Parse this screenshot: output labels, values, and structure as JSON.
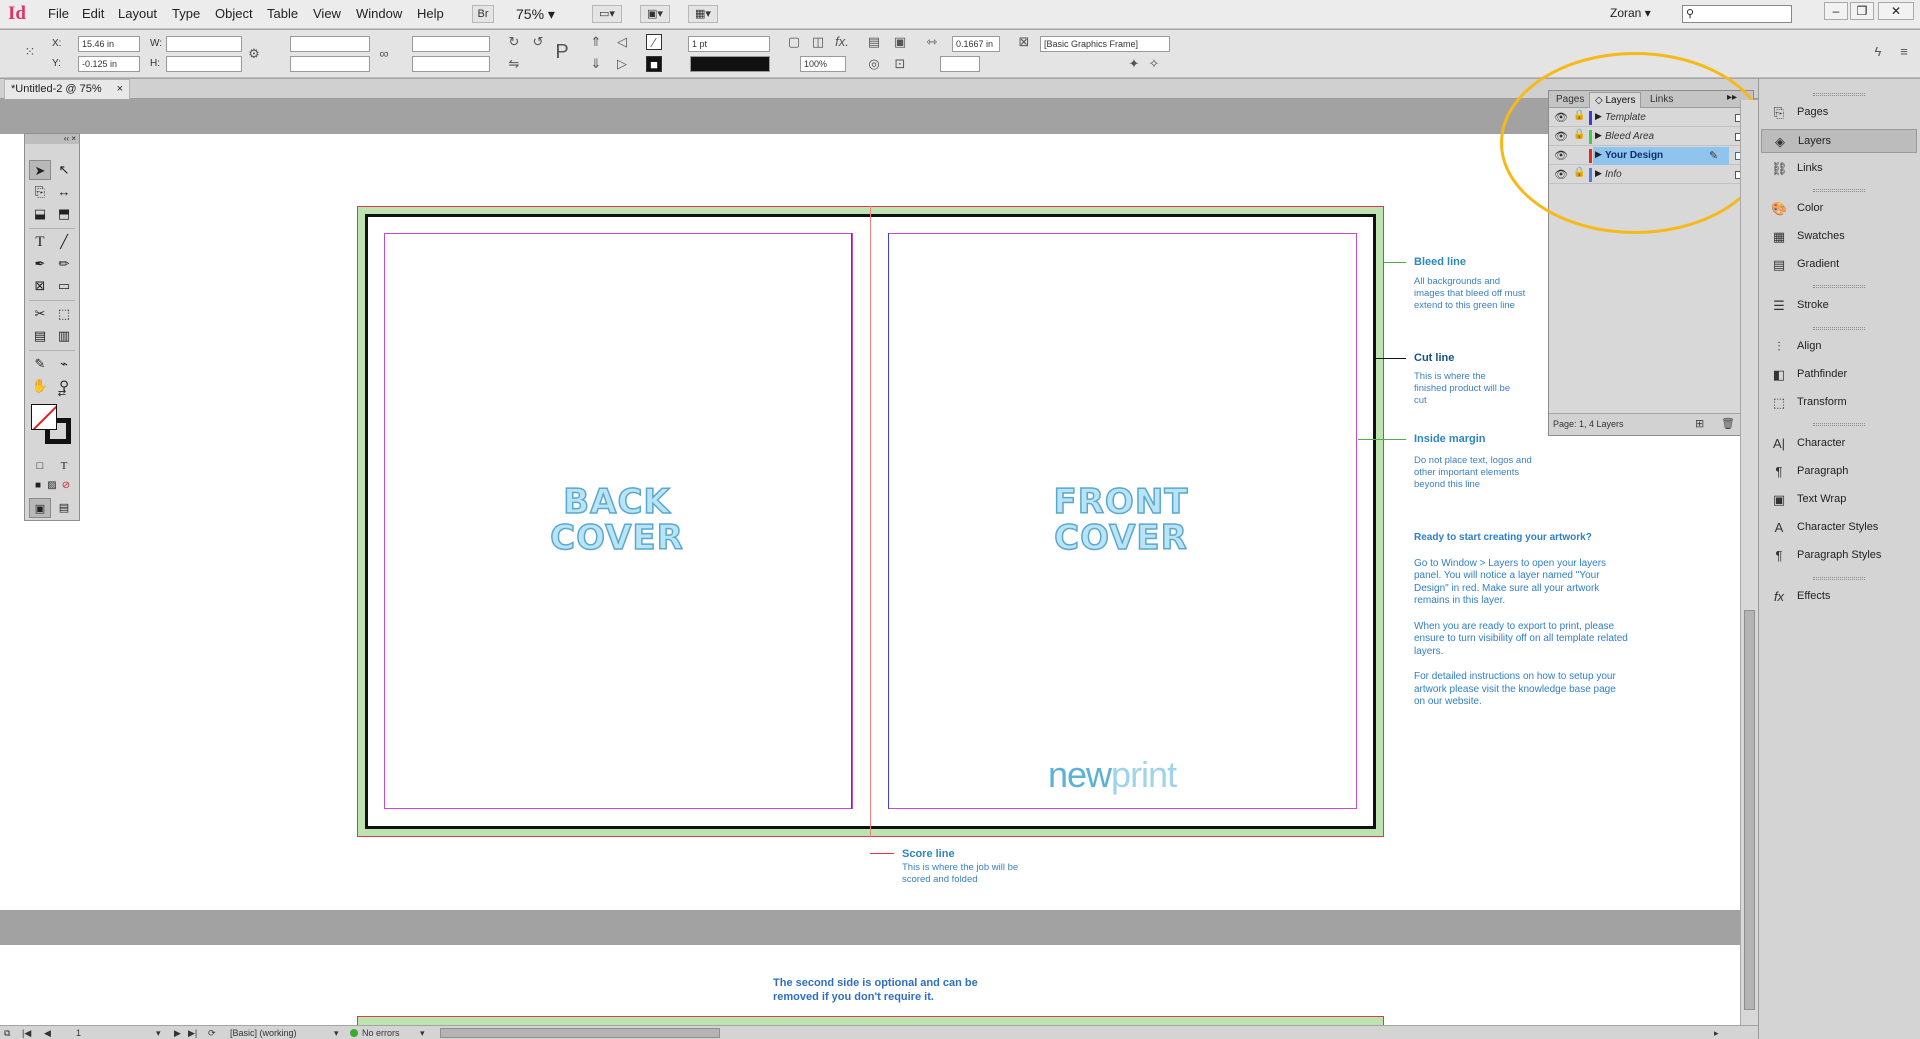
{
  "app": {
    "logo": "Id"
  },
  "menu": {
    "items": [
      "File",
      "Edit",
      "Layout",
      "Type",
      "Object",
      "Table",
      "View",
      "Window",
      "Help"
    ],
    "bridge_label": "Br",
    "zoom": "75%",
    "user": "Zoran"
  },
  "control": {
    "x_label": "X:",
    "y_label": "Y:",
    "w_label": "W:",
    "h_label": "H:",
    "x": "15.46 in",
    "y": "-0.125 in",
    "stroke_weight": "1 pt",
    "opacity": "100%",
    "offset": "0.1667 in",
    "object_style": "[Basic Graphics Frame]"
  },
  "document": {
    "tab_title": "*Untitled-2 @ 75%",
    "close_symbol": "×"
  },
  "artwork": {
    "back_cover": "BACK\nCOVER",
    "front_cover": "FRONT\nCOVER",
    "logo_part1": "new",
    "logo_part2": "print",
    "notes": {
      "bleed_title": "Bleed line",
      "bleed_body": "All backgrounds and images that bleed off must extend to this green line",
      "cut_title": "Cut line",
      "cut_body": "This is where the finished product will be cut",
      "margin_title": "Inside margin",
      "margin_body": "Do not place text, logos and other important elements beyond this line",
      "score_title": "Score line",
      "score_body": "This is where the job will be scored and folded"
    },
    "instructions": {
      "lead": "Ready to start creating your artwork?",
      "p1": "Go to Window > Layers to open your layers panel. You will notice a layer named \"Your Design\" in red. Make sure all your artwork remains in this layer.",
      "p2": "When you are ready to export to print, please ensure to turn visibility off on all template related layers.",
      "p3": "For detailed instructions on how to setup your artwork please visit the knowledge base page on our website."
    },
    "second_side": "The second side is optional and can be removed if you don't require it."
  },
  "layers_panel": {
    "tabs": [
      "Pages",
      "Layers",
      "Links"
    ],
    "active_tab": "Layers",
    "layers": [
      {
        "name": "Template",
        "color": "#3b3bdc",
        "locked": true,
        "selected": false
      },
      {
        "name": "Bleed Area",
        "color": "#46c84a",
        "locked": true,
        "selected": false
      },
      {
        "name": "Your Design",
        "color": "#e02a2a",
        "locked": false,
        "selected": true
      },
      {
        "name": "Info",
        "color": "#4a7fe0",
        "locked": true,
        "selected": false
      }
    ],
    "status": "Page: 1, 4 Layers"
  },
  "dock": {
    "items": [
      {
        "label": "Pages",
        "icon": "pages-icon"
      },
      {
        "label": "Layers",
        "icon": "layers-icon"
      },
      {
        "label": "Links",
        "icon": "links-icon"
      },
      {
        "label": "Color",
        "icon": "color-icon"
      },
      {
        "label": "Swatches",
        "icon": "swatches-icon"
      },
      {
        "label": "Gradient",
        "icon": "gradient-icon"
      },
      {
        "label": "Stroke",
        "icon": "stroke-icon"
      },
      {
        "label": "Align",
        "icon": "align-icon"
      },
      {
        "label": "Pathfinder",
        "icon": "pathfinder-icon"
      },
      {
        "label": "Transform",
        "icon": "transform-icon"
      },
      {
        "label": "Character",
        "icon": "character-icon"
      },
      {
        "label": "Paragraph",
        "icon": "paragraph-icon"
      },
      {
        "label": "Text Wrap",
        "icon": "text-wrap-icon"
      },
      {
        "label": "Character Styles",
        "icon": "character-styles-icon"
      },
      {
        "label": "Paragraph Styles",
        "icon": "paragraph-styles-icon"
      },
      {
        "label": "Effects",
        "icon": "effects-icon"
      }
    ],
    "selected": "Layers"
  },
  "statusbar": {
    "page": "1",
    "profile": "[Basic] (working)",
    "errors": "No errors"
  },
  "colors": {
    "accent_highlight": "#f6b918",
    "bleed_green": "#bde3b0",
    "margin_magenta": "#c24bd0",
    "note_blue": "#2e86c1"
  }
}
